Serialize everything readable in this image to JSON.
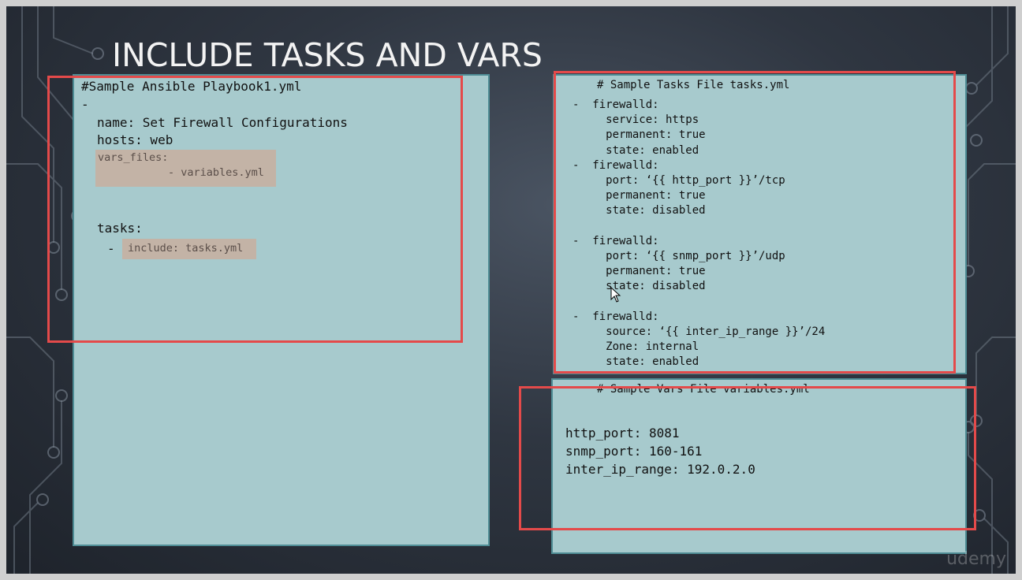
{
  "title": "INCLUDE TASKS AND VARS",
  "playbook": {
    "header": "#Sample Ansible Playbook1.yml",
    "dash": "-",
    "name_line": "name: Set Firewall Configurations",
    "hosts_line": "hosts: web",
    "vars_files_label": "vars_files:",
    "vars_files_item": "- variables.yml",
    "tasks_label": "tasks:",
    "tasks_dash": "-",
    "include_line": "include: tasks.yml"
  },
  "tasks_file": {
    "header": "# Sample Tasks File tasks.yml",
    "lines": [
      "-  firewalld:",
      "     service: https",
      "     permanent: true",
      "     state: enabled",
      "-  firewalld:",
      "     port: ‘{{ http_port }}’/tcp",
      "     permanent: true",
      "     state: disabled",
      "",
      "-  firewalld:",
      "     port: ‘{{ snmp_port }}’/udp",
      "     permanent: true",
      "     state: disabled",
      "",
      "-  firewalld:",
      "     source: ‘{{ inter_ip_range }}’/24",
      "     Zone: internal",
      "     state: enabled"
    ]
  },
  "vars_file": {
    "header": "# Sample Vars File variables.yml",
    "lines": [
      "http_port: 8081",
      "snmp_port: 160-161",
      "inter_ip_range: 192.0.2.0"
    ]
  },
  "watermark": "udemy",
  "colors": {
    "panel": "#a7cacd",
    "panel_border": "#4f8d95",
    "highlight_box": "#e44a4a",
    "code_highlight": "#c3b3a6"
  }
}
